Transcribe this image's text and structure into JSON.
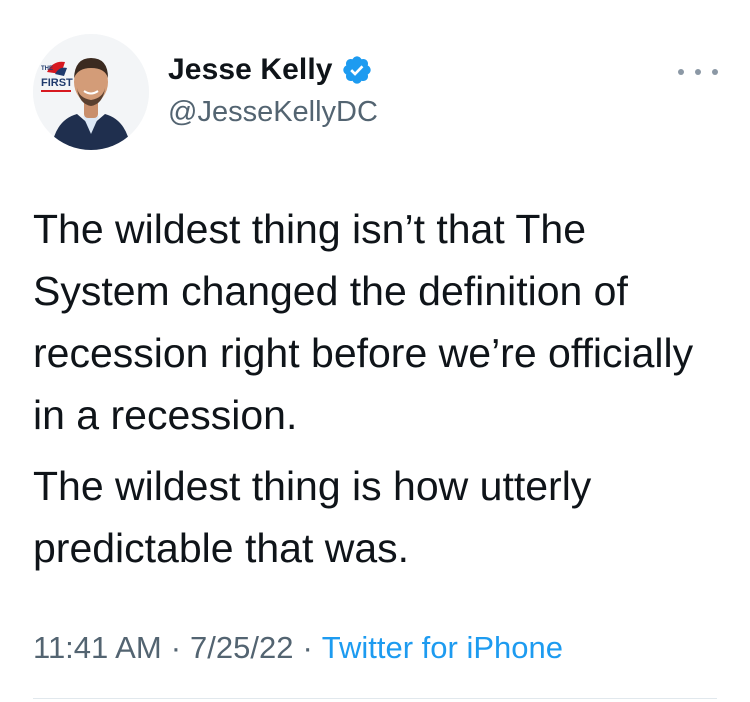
{
  "author": {
    "display_name": "Jesse Kelly",
    "handle": "@JesseKellyDC",
    "verified": true,
    "avatar_logo_text": "FIRST",
    "avatar_logo_small_text": "THE"
  },
  "tweet": {
    "paragraphs": [
      "The wildest thing isn’t that The System changed the definition of recession right before we’re officially in a recession.",
      "The wildest thing is how utterly predictable that was."
    ],
    "time": "11:41 AM",
    "date": "7/25/22",
    "separator": "·",
    "source": "Twitter for iPhone"
  },
  "icons": {
    "verified": "verified-badge-icon",
    "more": "more-options-icon"
  },
  "colors": {
    "text_primary": "#0f1419",
    "text_secondary": "#536471",
    "link": "#1d9bf0",
    "verified": "#1d9bf0"
  }
}
